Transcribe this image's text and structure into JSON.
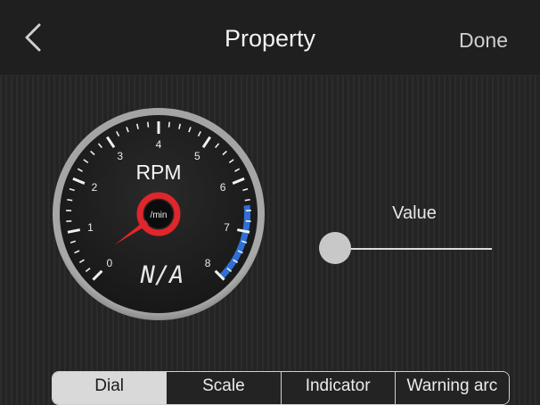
{
  "header": {
    "title": "Property",
    "done_label": "Done",
    "back_icon": "chevron-left-icon"
  },
  "gauge": {
    "unit_title": "RPM",
    "hub_label": "/min",
    "readout": "N/A",
    "scale_labels": [
      "0",
      "1",
      "2",
      "3",
      "4",
      "5",
      "6",
      "7",
      "8"
    ],
    "scale_min": 0,
    "scale_max": 8,
    "warning_arc": {
      "from": 6.5,
      "to": 8,
      "color": "#2f6fd6"
    },
    "needle_value": 0.3,
    "colors": {
      "hub": "#e0262c",
      "bezel": "#9a9a9a",
      "face": "#1e1e1e"
    }
  },
  "value_control": {
    "label": "Value",
    "level": 0
  },
  "tabs": [
    {
      "label": "Dial",
      "active": true
    },
    {
      "label": "Scale",
      "active": false
    },
    {
      "label": "Indicator",
      "active": false
    },
    {
      "label": "Warning arc",
      "active": false
    }
  ]
}
